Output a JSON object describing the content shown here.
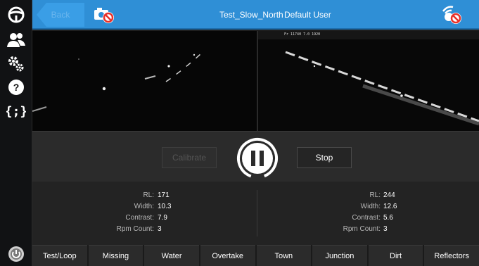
{
  "header": {
    "back_label": "Back",
    "test_name": "Test_Slow_North",
    "user_name": "Default User",
    "camera_status_icon": "camera-disabled-icon",
    "gps_status_icon": "gps-disabled-icon",
    "accent_color": "#2f8fd6"
  },
  "sidebar": {
    "items": [
      {
        "icon": "steering-wheel-icon"
      },
      {
        "icon": "users-icon"
      },
      {
        "icon": "settings-icon"
      },
      {
        "icon": "help-icon"
      },
      {
        "icon": "code-icon"
      },
      {
        "icon": "power-icon"
      }
    ]
  },
  "camera": {
    "overlay_text": "Fr 11740 7.0 1920"
  },
  "controls": {
    "calibrate_label": "Calibrate",
    "stop_label": "Stop",
    "pause_icon": "pause-icon"
  },
  "stats": {
    "left": [
      {
        "label": "RL:",
        "value": "171"
      },
      {
        "label": "Width:",
        "value": "10.3"
      },
      {
        "label": "Contrast:",
        "value": "7.9"
      },
      {
        "label": "Rpm Count:",
        "value": "3"
      }
    ],
    "right": [
      {
        "label": "RL:",
        "value": "244"
      },
      {
        "label": "Width:",
        "value": "12.6"
      },
      {
        "label": "Contrast:",
        "value": "5.6"
      },
      {
        "label": "Rpm Count:",
        "value": "3"
      }
    ]
  },
  "tabs": [
    "Test/Loop",
    "Missing",
    "Water",
    "Overtake",
    "Town",
    "Junction",
    "Dirt",
    "Reflectors"
  ]
}
